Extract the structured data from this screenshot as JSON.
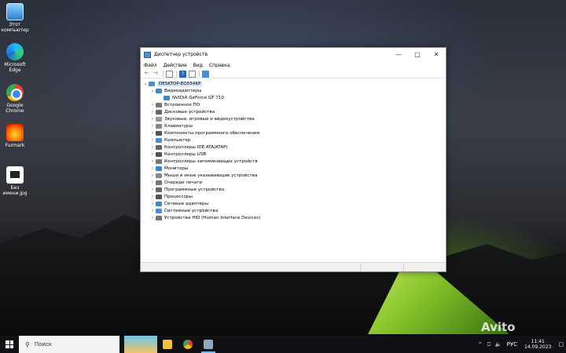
{
  "desktop": {
    "icons": [
      {
        "label": "Этот компьютер",
        "icon": "computer-icon"
      },
      {
        "label": "Microsoft Edge",
        "icon": "edge-icon"
      },
      {
        "label": "Google Chrome",
        "icon": "chrome-icon"
      },
      {
        "label": "Furmark",
        "icon": "furmark-icon"
      },
      {
        "label": "Без имени.jpg",
        "icon": "image-file-icon"
      }
    ],
    "watermark": "Avito"
  },
  "window": {
    "title": "Диспетчер устройств",
    "menu": [
      "Файл",
      "Действие",
      "Вид",
      "Справка"
    ],
    "tree": {
      "root": "DESKTOP-EQ554KP",
      "items": [
        {
          "label": "Видеоадаптеры",
          "expanded": true,
          "children": [
            "NVIDIA GeForce GT 710"
          ]
        },
        {
          "label": "Встроенное ПО"
        },
        {
          "label": "Дисковые устройства"
        },
        {
          "label": "Звуковые, игровые и видеоустройства"
        },
        {
          "label": "Клавиатуры"
        },
        {
          "label": "Компоненты программного обеспечения"
        },
        {
          "label": "Компьютер"
        },
        {
          "label": "Контроллеры IDE ATA/ATAPI"
        },
        {
          "label": "Контроллеры USB"
        },
        {
          "label": "Контроллеры запоминающих устройств"
        },
        {
          "label": "Мониторы"
        },
        {
          "label": "Мыши и иные указывающие устройства"
        },
        {
          "label": "Очереди печати"
        },
        {
          "label": "Программные устройства"
        },
        {
          "label": "Процессоры"
        },
        {
          "label": "Сетевые адаптеры"
        },
        {
          "label": "Системные устройства"
        },
        {
          "label": "Устройства HID (Human Interface Devices)"
        }
      ]
    }
  },
  "taskbar": {
    "search_placeholder": "Поиск",
    "language": "РУС",
    "time": "11:41",
    "date": "14.09.2023"
  }
}
